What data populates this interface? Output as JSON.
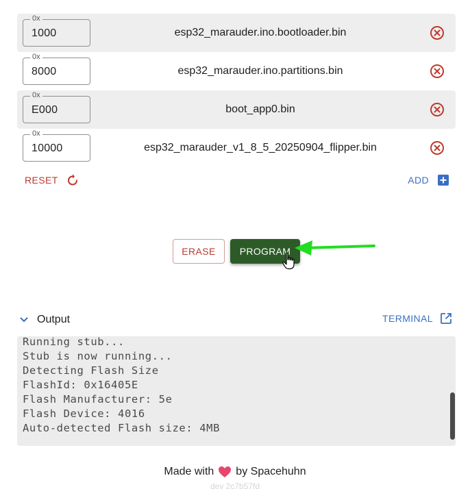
{
  "files": [
    {
      "address_label": "0x",
      "address": "1000",
      "name": "esp32_marauder.ino.bootloader.bin",
      "shaded": true
    },
    {
      "address_label": "0x",
      "address": "8000",
      "name": "esp32_marauder.ino.partitions.bin",
      "shaded": false
    },
    {
      "address_label": "0x",
      "address": "E000",
      "name": "boot_app0.bin",
      "shaded": true
    },
    {
      "address_label": "0x",
      "address": "10000",
      "name": "esp32_marauder_v1_8_5_20250904_flipper.bin",
      "shaded": false
    }
  ],
  "actions": {
    "reset_label": "RESET",
    "add_label": "ADD",
    "erase_label": "ERASE",
    "program_label": "PROGRAM"
  },
  "output": {
    "title": "Output",
    "terminal_label": "TERMINAL",
    "lines": [
      "Running stub...",
      "Stub is now running...",
      "Detecting Flash Size",
      "FlashId: 0x16405E",
      "Flash Manufacturer: 5e",
      "Flash Device: 4016",
      "Auto-detected Flash size: 4MB"
    ]
  },
  "footer": {
    "made_with": "Made with",
    "by": "by Spacehuhn",
    "version": "dev 2c7b57fd"
  },
  "colors": {
    "accent_blue": "#3a6fc4",
    "danger_red": "#c0392b",
    "program_green": "#2d5b28",
    "annotation_arrow": "#22dd22",
    "heart": "#e5476b"
  },
  "icons": {
    "remove": "close-circle-icon",
    "reset": "refresh-icon",
    "add": "plus-box-icon",
    "collapse": "chevron-down-icon",
    "terminal": "open-in-new-icon",
    "heart": "heart-icon",
    "cursor": "hand-pointer-icon"
  }
}
